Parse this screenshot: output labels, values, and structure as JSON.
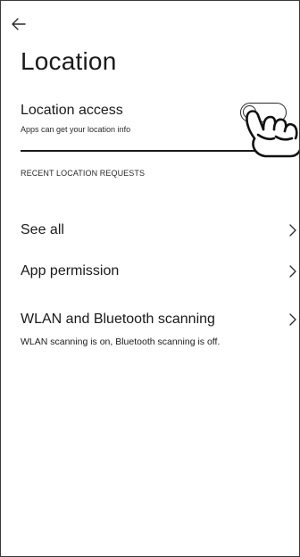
{
  "header": {
    "title": "Location"
  },
  "location_access": {
    "title": "Location access",
    "subtitle": "Apps can get your location info",
    "enabled": false
  },
  "recent_requests": {
    "header": "RECENT LOCATION REQUESTS"
  },
  "menu": {
    "see_all": "See all",
    "app_permission": "App permission",
    "wlan_bt": {
      "title": "WLAN and Bluetooth scanning",
      "description": "WLAN scanning is on, Bluetooth scanning is off."
    }
  },
  "icons": {
    "back": "arrow-left-icon",
    "chevron": "chevron-right-icon",
    "hand": "pointing-hand-icon"
  },
  "colors": {
    "background": "#ffffff",
    "text": "#1a1a1a",
    "stroke": "#2a2a2a"
  }
}
